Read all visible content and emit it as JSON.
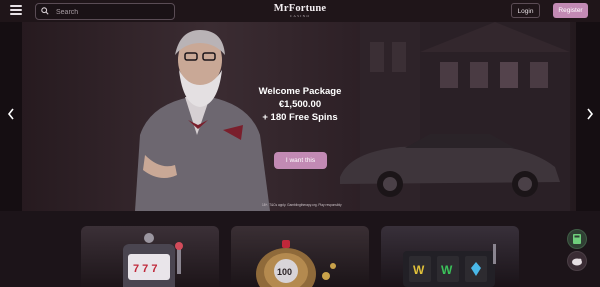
{
  "header": {
    "search_placeholder": "Search",
    "logo": "MrFortune",
    "logo_sub": "CASINO",
    "login_label": "Login",
    "register_label": "Register"
  },
  "hero": {
    "line1": "Welcome Package",
    "line2": "€1,500.00",
    "line3": "+ 180 Free Spins",
    "cta_label": "I want this",
    "disclaimer": "18+. T&Cs apply. Gamblingtherapy.org. Play responsibly",
    "slides_total": 3,
    "active_slide": 1
  },
  "colors": {
    "accent": "#c28ab4",
    "background": "#1c1419"
  },
  "tiles": [
    {
      "icon": "slot-machine-icon"
    },
    {
      "icon": "roulette-100-icon"
    },
    {
      "icon": "reels-icon"
    }
  ],
  "fabs": [
    {
      "icon": "calculator-icon"
    },
    {
      "icon": "piggy-bank-icon"
    }
  ]
}
